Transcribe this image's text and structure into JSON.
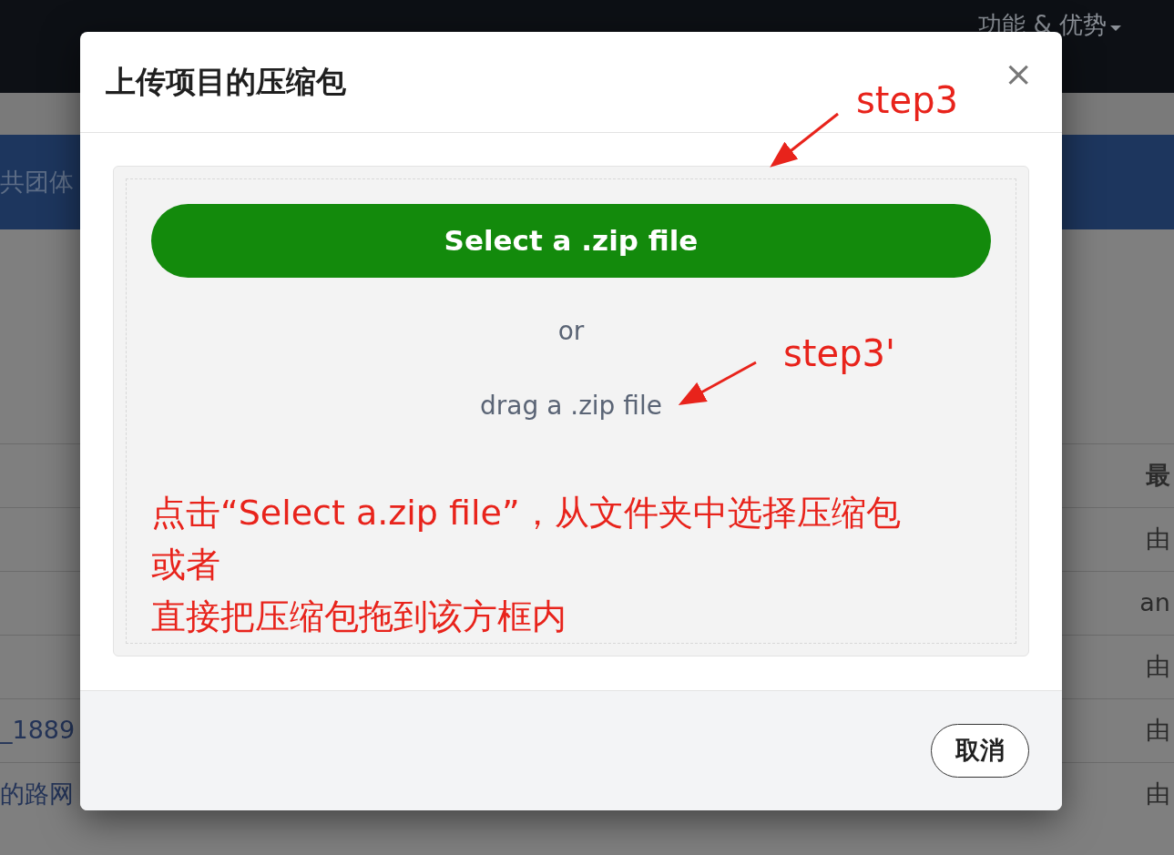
{
  "page": {
    "nav_link": "功能 & 优势",
    "banner_text": "共团体",
    "table": {
      "header": {
        "column_2": "最"
      },
      "rows": [
        {
          "column_2": "由"
        },
        {
          "column_2": "an"
        },
        {
          "column_2": "由"
        },
        {
          "column_1": "_1889",
          "column_2": "由"
        },
        {
          "column_1": "的路网",
          "column_2": "由"
        }
      ]
    }
  },
  "modal": {
    "title": "上传项目的压缩包",
    "close": "×",
    "select_button": "Select a .zip file",
    "or": "or",
    "drag_hint": "drag a .zip file",
    "cancel_button": "取消"
  },
  "annotations": [
    {
      "kind": "arrow_label",
      "text": "step3"
    },
    {
      "kind": "arrow_label",
      "text": "step3'"
    },
    {
      "kind": "note",
      "lines": [
        "点击“Select a.zip file”，从文件夹中选择压缩包",
        "或者",
        "直接把压缩包拖到该方框内"
      ]
    }
  ]
}
